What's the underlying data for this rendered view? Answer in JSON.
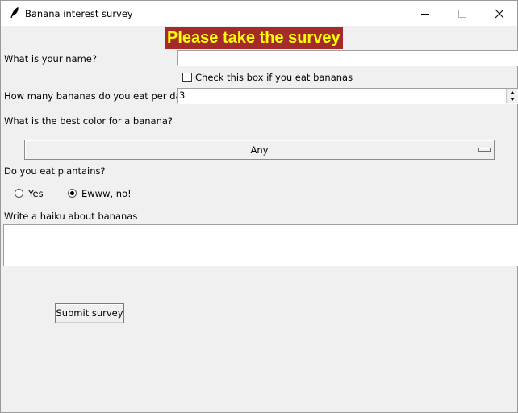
{
  "window": {
    "title": "Banana interest survey",
    "icons": {
      "app": "feather-icon",
      "minimize": "minimize-icon",
      "maximize": "maximize-icon",
      "close": "close-icon"
    }
  },
  "heading": {
    "text": "Please take the survey",
    "bg_color": "#a52a2a",
    "fg_color": "#ffff00"
  },
  "name": {
    "label": "What is your name?",
    "value": ""
  },
  "eats_bananas": {
    "label": "Check this box if you eat bananas",
    "checked": false
  },
  "bananas_per_day": {
    "label": "How many bananas do you eat per day?",
    "value": "3"
  },
  "color": {
    "label": "What is the best color for a banana?",
    "selected": "Any"
  },
  "plantains": {
    "label": "Do you eat plantains?",
    "options": [
      {
        "label": "Yes",
        "selected": false
      },
      {
        "label": "Ewww, no!",
        "selected": true
      }
    ]
  },
  "haiku": {
    "label": "Write a haiku about bananas",
    "value": ""
  },
  "submit": {
    "label": "Submit survey"
  }
}
